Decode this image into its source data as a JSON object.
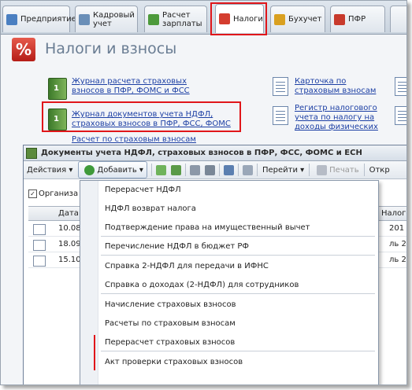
{
  "tabs": [
    {
      "label": "Предприятие",
      "color": "#4a7fc1",
      "active": false
    },
    {
      "label": "Кадровый\nучет",
      "color": "#6a8fb8",
      "active": false
    },
    {
      "label": "Расчет\nзарплаты",
      "color": "#4d9a3c",
      "active": false
    },
    {
      "label": "Налоги",
      "color": "#d43d2f",
      "active": true
    },
    {
      "label": "Бухучет",
      "color": "#d9a020",
      "active": false
    },
    {
      "label": "ПФР",
      "color": "#c83a2c",
      "active": false
    }
  ],
  "section": {
    "icon": "%",
    "title": "Налоги и взносы"
  },
  "links": {
    "left": [
      "Журнал расчета страховых\nвзносов в ПФР, ФОМС и ФСС",
      "Журнал документов учета НДФЛ,\nстраховых взносов в ПФР, ФСС, ФОМС",
      "Расчет по страховым взносам"
    ],
    "right": [
      "Карточка по\nстраховым взносам",
      "Регистр налогового\nучета по налогу на\nдоходы физических"
    ]
  },
  "window": {
    "title": "Документы учета НДФЛ, страховых взносов в ПФР, ФСС, ФОМС и ЕСН",
    "toolbar": {
      "actions": "Действия",
      "add": "Добавить",
      "goto": "Перейти",
      "print": "Печать",
      "open": "Откр"
    },
    "filter_label": "Организа",
    "columns": {
      "date": "Дата",
      "taxes": "Налогов..."
    },
    "rows": [
      {
        "date": "10.08",
        "right": "201"
      },
      {
        "date": "18.09",
        "right": "ль 2"
      },
      {
        "date": "15.10",
        "right": "ль 2"
      }
    ]
  },
  "menu": {
    "items": [
      "Перерасчет НДФЛ",
      "НДФЛ возврат налога",
      "Подтверждение права на имущественный вычет",
      "Перечисление НДФЛ в бюджет РФ",
      "Справка 2-НДФЛ для передачи в ИФНС",
      "Справка о доходах (2-НДФЛ) для сотрудников",
      "Начисление страховых взносов",
      "Расчеты по страховым взносам",
      "Перерасчет страховых взносов",
      "Акт проверки страховых взносов"
    ]
  },
  "colors": {
    "highlight": "#e0161a",
    "link": "#1c3fa4"
  }
}
